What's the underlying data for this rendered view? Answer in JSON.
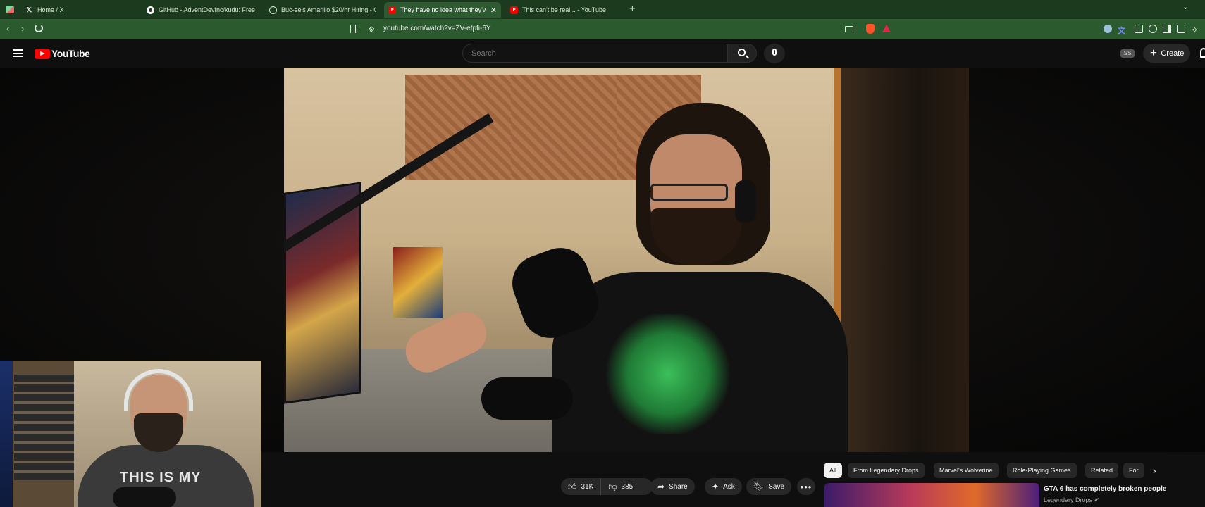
{
  "browser": {
    "tabs": [
      {
        "title": "Home / X",
        "icon": "x-icon"
      },
      {
        "title": "GitHub - AdventDevInc/kudu: Free W",
        "icon": "github-icon"
      },
      {
        "title": "Buc-ee's Amarillo $20/hr Hiring - Gr",
        "icon": "globe-icon"
      },
      {
        "title": "They have no idea what they've",
        "icon": "youtube-icon",
        "active": true
      },
      {
        "title": "This can't be real... - YouTube",
        "icon": "youtube-icon"
      }
    ],
    "url": "youtube.com/watch?v=ZV-efpfi-6Y"
  },
  "youtube": {
    "logo_text": "YouTube",
    "search_placeholder": "Search",
    "avatar_initials": "SS",
    "create_label": "Create"
  },
  "facecam": {
    "shirt_text": "THIS IS MY"
  },
  "actions": {
    "likes": "31K",
    "dislikes": "385",
    "share": "Share",
    "ask": "Ask",
    "save": "Save"
  },
  "chips": [
    "All",
    "From Legendary Drops",
    "Marvel's Wolverine",
    "Role-Playing Games",
    "Related",
    "For"
  ],
  "recommendation": {
    "title": "GTA 6 has completely broken people",
    "channel": "Legendary Drops"
  },
  "colors": {
    "tab_strip": "#1c3a1e",
    "address_bar": "#2c5a2f",
    "youtube_red": "#ff0000",
    "page_bg": "#0f0f0f"
  }
}
